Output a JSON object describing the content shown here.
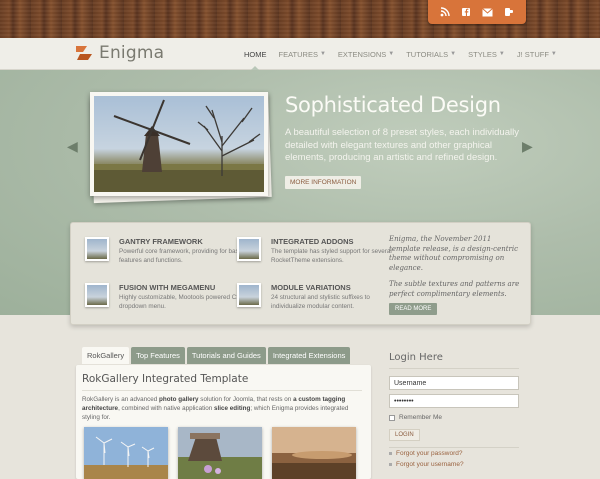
{
  "brand": {
    "name": "Enigma",
    "accent": "#d8743a"
  },
  "social": {
    "icons": [
      "rss-icon",
      "facebook-icon",
      "email-icon",
      "twitter-icon"
    ]
  },
  "nav": {
    "items": [
      {
        "label": "HOME",
        "active": true,
        "dropdown": false
      },
      {
        "label": "FEATURES",
        "dropdown": true
      },
      {
        "label": "EXTENSIONS",
        "dropdown": true
      },
      {
        "label": "TUTORIALS",
        "dropdown": true
      },
      {
        "label": "STYLES",
        "dropdown": true
      },
      {
        "label": "J! STUFF",
        "dropdown": true
      }
    ]
  },
  "showcase": {
    "title": "Sophisticated Design",
    "description": "A beautiful selection of 8 preset styles, each individually detailed with elegant textures and other graphical elements, producing an artistic and refined design.",
    "button": "MORE INFORMATION"
  },
  "features": {
    "items": [
      {
        "title": "GANTRY FRAMEWORK",
        "desc": "Powerful core framework, providing for base features and functions."
      },
      {
        "title": "INTEGRATED ADDONS",
        "desc": "The template has styled support for several RocketTheme extensions."
      },
      {
        "title": "FUSION WITH MEGAMENU",
        "desc": "Highly customizable, Mootools powered CSS dropdown menu."
      },
      {
        "title": "MODULE VARIATIONS",
        "desc": "24 structural and stylistic suffixes to individualize modular content."
      }
    ],
    "quote1": "Enigma, the November 2011 template release, is a design-centric theme without compromising on elegance.",
    "quote2": "The subtle textures and patterns are perfect complimentary elements.",
    "button": "READ MORE"
  },
  "tabs": [
    "RokGallery",
    "Top Features",
    "Tutorials and Guides",
    "Integrated Extensions"
  ],
  "content": {
    "title": "RokGallery Integrated Template",
    "text_a": "RokGallery is an advanced ",
    "text_b": "photo gallery",
    "text_c": " solution for Joomla, that rests on ",
    "text_d": "a custom tagging architecture",
    "text_e": ", combined with native application ",
    "text_f": "slice editing",
    "text_g": "; which Enigma provides integrated styling for."
  },
  "login": {
    "title": "Login Here",
    "username": "Username",
    "password": "••••••••",
    "remember": "Remember Me",
    "button": "LOGIN",
    "forgot_password": "Forgot your password?",
    "forgot_username": "Forgot your username?"
  }
}
